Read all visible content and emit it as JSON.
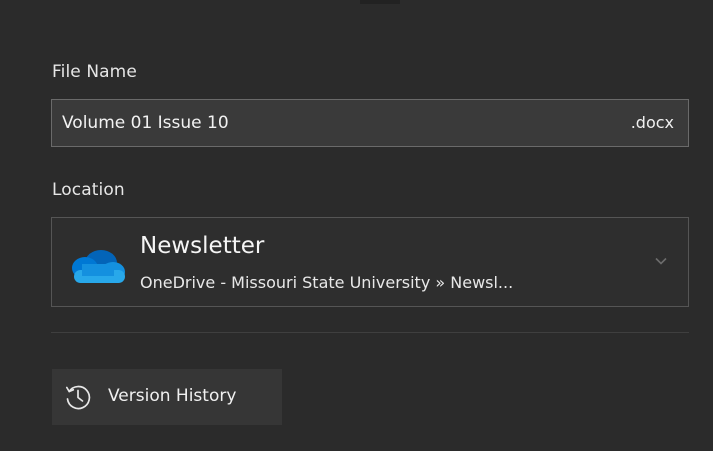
{
  "file_name": {
    "label": "File Name",
    "value": "Volume 01 Issue 10",
    "extension": ".docx"
  },
  "location": {
    "label": "Location",
    "title": "Newsletter",
    "path": "OneDrive - Missouri State University » Newsl...",
    "icon": "onedrive-cloud-icon"
  },
  "version_history": {
    "label": "Version History",
    "icon": "history-icon"
  },
  "colors": {
    "panel_background": "#2b2b2b",
    "input_background": "#3a3a3a",
    "onedrive_blue": "#0a78d4",
    "text": "#f0f0f0"
  }
}
